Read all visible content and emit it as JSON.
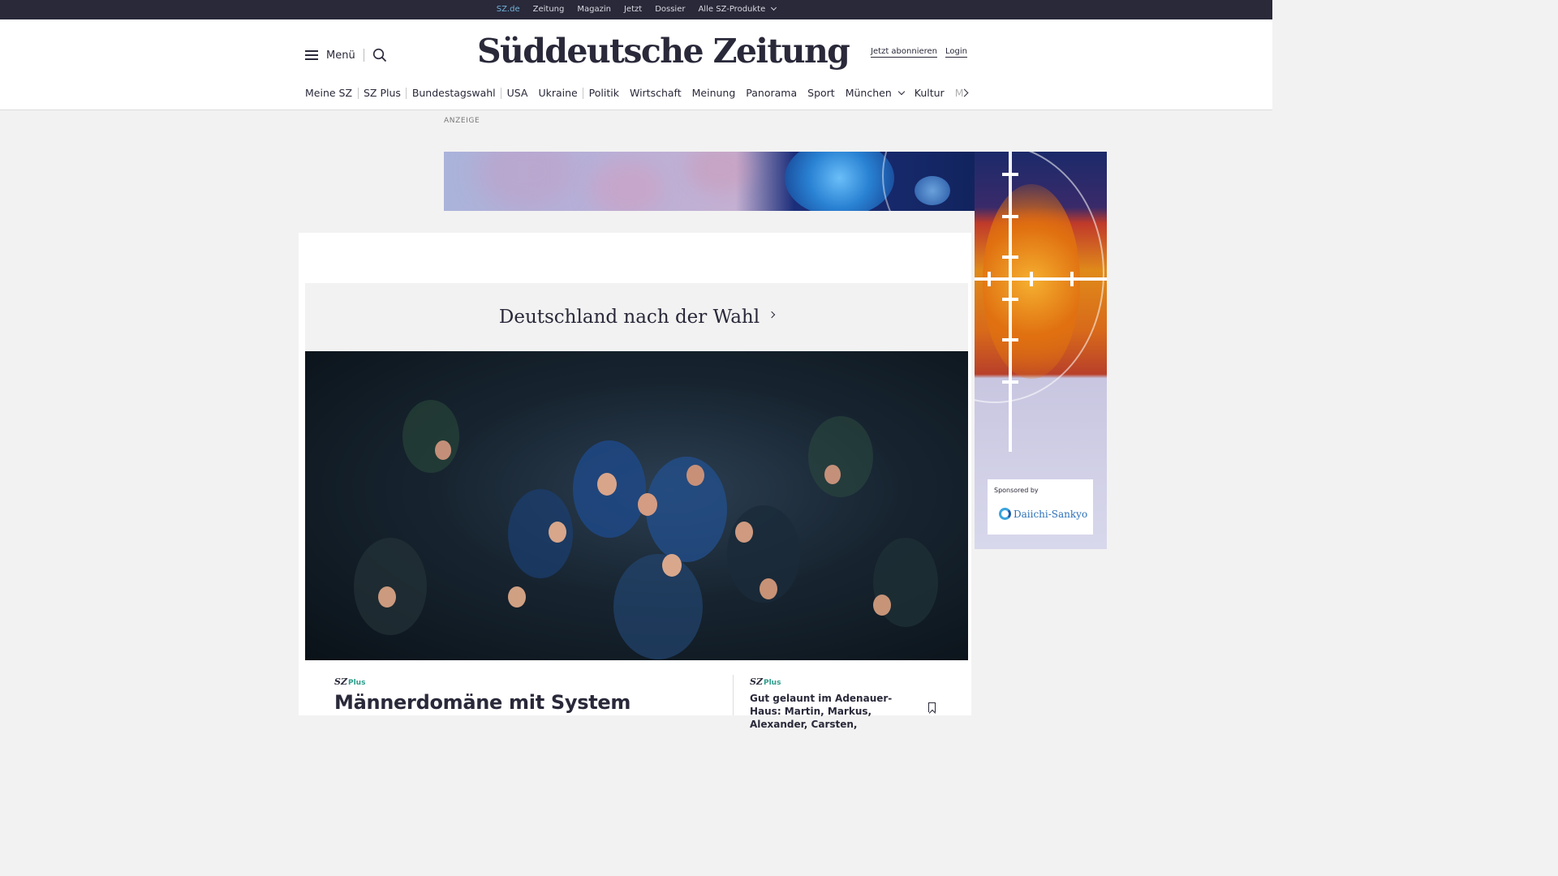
{
  "topbar": {
    "items": [
      "SZ.de",
      "Zeitung",
      "Magazin",
      "Jetzt",
      "Dossier",
      "Alle SZ-Produkte"
    ],
    "active": "SZ.de"
  },
  "header": {
    "menu_label": "Menü",
    "logo_text": "Süddeutsche Zeitung",
    "subscribe_label": "Jetzt abonnieren",
    "login_label": "Login"
  },
  "nav": {
    "items": [
      "Meine SZ",
      "SZ Plus",
      "Bundestagswahl",
      "USA",
      "Ukraine",
      "Politik",
      "Wirtschaft",
      "Meinung",
      "Panorama",
      "Sport",
      "München",
      "Kultur",
      "M"
    ]
  },
  "ad": {
    "label": "ANZEIGE",
    "sponsored_by": "Sponsored by",
    "sponsor_name": "Daiichi-Sankyo"
  },
  "dossier": {
    "title": "Deutschland nach der Wahl"
  },
  "teaser": {
    "badge_sz": "SZ",
    "badge_plus": "Plus",
    "headline": "Männerdomäne mit System",
    "side_headline": "Gut gelaunt im Adenauer-Haus: Martin, Markus, Alexander, Carsten,"
  },
  "colors": {
    "topbar_bg": "#29293a",
    "active_link": "#71b2d8",
    "plus_accent": "#2a9c8a",
    "page_bg": "#f2f2f2"
  }
}
